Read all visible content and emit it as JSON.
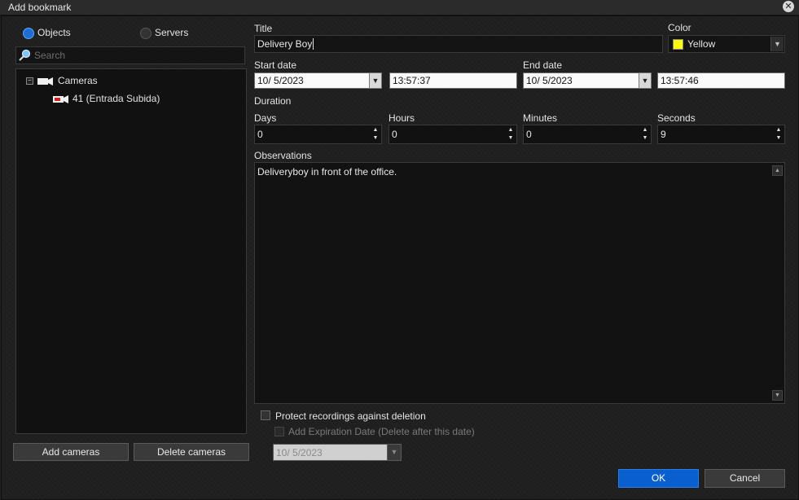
{
  "window": {
    "title": "Add bookmark"
  },
  "left": {
    "radio_objects": "Objects",
    "radio_servers": "Servers",
    "search_placeholder": "Search",
    "tree": {
      "root": "Cameras",
      "children": [
        "41 (Entrada Subida)"
      ]
    },
    "add_button": "Add cameras",
    "delete_button": "Delete cameras"
  },
  "form": {
    "title_label": "Title",
    "title_value": "Delivery Boy",
    "color_label": "Color",
    "color_value": "Yellow",
    "color_swatch": "#ffff00",
    "start_date_label": "Start date",
    "start_date": "10/  5/2023",
    "start_time": "13:57:37",
    "end_date_label": "End date",
    "end_date": "10/  5/2023",
    "end_time": "13:57:46",
    "duration_label": "Duration",
    "days_label": "Days",
    "days": "0",
    "hours_label": "Hours",
    "hours": "0",
    "minutes_label": "Minutes",
    "minutes": "0",
    "seconds_label": "Seconds",
    "seconds": "9",
    "observations_label": "Observations",
    "observations": "Deliveryboy in front of the office.",
    "protect_label": "Protect recordings against deletion",
    "expiration_label": "Add Expiration Date (Delete after this date)",
    "expiration_date": "10/  5/2023"
  },
  "footer": {
    "ok": "OK",
    "cancel": "Cancel"
  },
  "colors": {
    "accent": "#0a5fd0",
    "background": "#1f1f1f"
  }
}
